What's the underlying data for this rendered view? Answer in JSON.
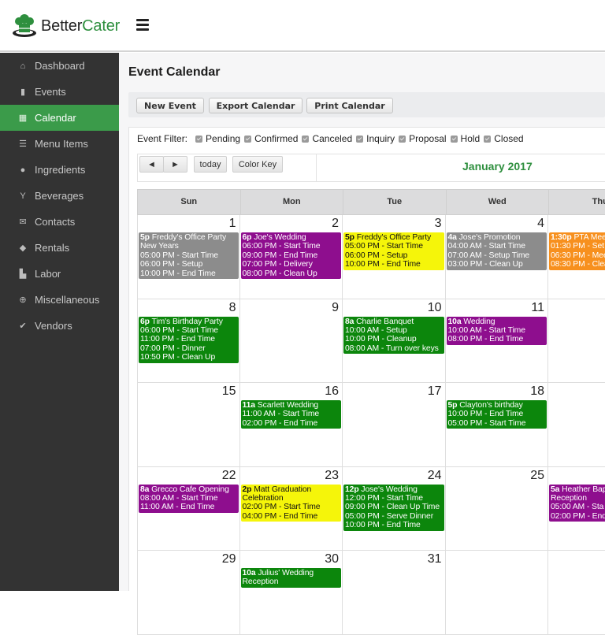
{
  "app": {
    "brand_part1": "Better",
    "brand_part2": "Cater"
  },
  "colors": {
    "brand": "#2e8f3e",
    "sidebar_bg": "#333333",
    "active": "#3b9b4a",
    "gray": "#8c8c8c",
    "purple": "#8e0e8e",
    "yellow": "#f5f50a",
    "green": "#0c860c",
    "orange": "#f7901e"
  },
  "sidebar": {
    "items": [
      {
        "label": "Dashboard",
        "icon": "home-icon",
        "glyph": "⌂",
        "active": false
      },
      {
        "label": "Events",
        "icon": "bookmark-icon",
        "glyph": "▮",
        "active": false
      },
      {
        "label": "Calendar",
        "icon": "calendar-icon",
        "glyph": "▦",
        "active": true
      },
      {
        "label": "Menu Items",
        "icon": "list-icon",
        "glyph": "☰",
        "active": false
      },
      {
        "label": "Ingredients",
        "icon": "apple-icon",
        "glyph": "●",
        "active": false
      },
      {
        "label": "Beverages",
        "icon": "glass-icon",
        "glyph": "Y",
        "active": false
      },
      {
        "label": "Contacts",
        "icon": "envelope-icon",
        "glyph": "✉",
        "active": false
      },
      {
        "label": "Rentals",
        "icon": "tag-icon",
        "glyph": "◆",
        "active": false
      },
      {
        "label": "Labor",
        "icon": "copy-icon",
        "glyph": "▙",
        "active": false
      },
      {
        "label": "Miscellaneous",
        "icon": "plus-circle-icon",
        "glyph": "⊕",
        "active": false
      },
      {
        "label": "Vendors",
        "icon": "check-icon",
        "glyph": "✔",
        "active": false
      }
    ]
  },
  "main": {
    "title": "Event Calendar",
    "toolbar": {
      "new_event": "New Event",
      "export": "Export Calendar",
      "print": "Print Calendar"
    },
    "filter": {
      "label": "Event Filter:",
      "options": [
        "Pending",
        "Confirmed",
        "Canceled",
        "Inquiry",
        "Proposal",
        "Hold",
        "Closed"
      ]
    },
    "nav": {
      "prev": "◄",
      "next": "►",
      "today": "today",
      "color_key": "Color Key",
      "month": "January 2017"
    },
    "weekdays": [
      "Sun",
      "Mon",
      "Tue",
      "Wed",
      "Thu"
    ],
    "weeks": [
      [
        {
          "day": "1",
          "event": {
            "color": "gray",
            "time": "5p",
            "title": "Freddy's Office Party",
            "lines": [
              "New Years",
              "05:00 PM - Start Time",
              "06:00 PM - Setup",
              "10:00 PM - End Time"
            ]
          }
        },
        {
          "day": "2",
          "event": {
            "color": "purple",
            "time": "6p",
            "title": "Joe's Wedding",
            "lines": [
              "06:00 PM - Start Time",
              "09:00 PM - End Time",
              "07:00 PM - Delivery",
              "08:00 PM - Clean Up"
            ]
          }
        },
        {
          "day": "3",
          "event": {
            "color": "yellow",
            "time": "5p",
            "title": "Freddy's Office Party",
            "lines": [
              "05:00 PM - Start Time",
              "06:00 PM - Setup",
              "10:00 PM - End Time"
            ]
          }
        },
        {
          "day": "4",
          "event": {
            "color": "gray",
            "time": "4a",
            "title": "Jose's Promotion",
            "lines": [
              "04:00 AM - Start Time",
              "07:00 AM - Setup Time",
              "03:00 PM - Clean Up"
            ]
          }
        },
        {
          "day": "",
          "event": {
            "color": "orange",
            "time": "1:30p",
            "title": "PTA Mee",
            "lines": [
              "01:30 PM - Set",
              "06:30 PM - Mee",
              "08:30 PM - Clea"
            ]
          }
        }
      ],
      [
        {
          "day": "8",
          "event": {
            "color": "green",
            "time": "6p",
            "title": "Tim's Birthday Party",
            "lines": [
              "06:00 PM - Start Time",
              "11:00 PM - End Time",
              "07:00 PM - Dinner",
              "10:50 PM - Clean Up"
            ]
          }
        },
        {
          "day": "9",
          "event": null
        },
        {
          "day": "10",
          "event": {
            "color": "green",
            "time": "8a",
            "title": "Charlie Banquet",
            "lines": [
              "10:00 AM - Setup",
              "10:00 PM - Cleanup",
              "08:00 AM - Turn over keys"
            ]
          }
        },
        {
          "day": "11",
          "event": {
            "color": "purple",
            "time": "10a",
            "title": "Wedding",
            "lines": [
              "10:00 AM - Start Time",
              "08:00 PM - End Time"
            ]
          }
        },
        {
          "day": "",
          "event": null
        }
      ],
      [
        {
          "day": "15",
          "event": null
        },
        {
          "day": "16",
          "event": {
            "color": "green",
            "time": "11a",
            "title": "Scarlett Wedding",
            "lines": [
              "11:00 AM - Start Time",
              "02:00 PM - End Time"
            ]
          }
        },
        {
          "day": "17",
          "event": null
        },
        {
          "day": "18",
          "event": {
            "color": "green",
            "time": "5p",
            "title": "Clayton's birthday",
            "lines": [
              "10:00 PM - End Time",
              "05:00 PM - Start Time"
            ]
          }
        },
        {
          "day": "",
          "event": null
        }
      ],
      [
        {
          "day": "22",
          "event": {
            "color": "purple",
            "time": "8a",
            "title": "Grecco Cafe Opening",
            "lines": [
              "08:00 AM - Start Time",
              "11:00 AM - End Time"
            ]
          }
        },
        {
          "day": "23",
          "event": {
            "color": "yellow",
            "time": "2p",
            "title": "Matt Graduation",
            "lines": [
              "Celebration",
              "02:00 PM - Start Time",
              "04:00 PM - End Time"
            ]
          }
        },
        {
          "day": "24",
          "event": {
            "color": "green",
            "time": "12p",
            "title": "Jose's Wedding",
            "lines": [
              "12:00 PM - Start Time",
              "09:00 PM - Clean Up Time",
              "05:00 PM - Serve Dinner",
              "10:00 PM - End Time"
            ]
          }
        },
        {
          "day": "25",
          "event": null
        },
        {
          "day": "",
          "event": {
            "color": "purple",
            "time": "5a",
            "title": "Heather Bap",
            "lines": [
              "Reception",
              "05:00 AM - Sta",
              "02:00 PM - End"
            ]
          }
        }
      ],
      [
        {
          "day": "29",
          "event": null
        },
        {
          "day": "30",
          "event": {
            "color": "green",
            "time": "10a",
            "title": "Julius' Wedding",
            "lines": [
              "Reception"
            ]
          }
        },
        {
          "day": "31",
          "event": null
        },
        {
          "day": "",
          "event": null
        },
        {
          "day": "",
          "event": null
        }
      ]
    ]
  }
}
